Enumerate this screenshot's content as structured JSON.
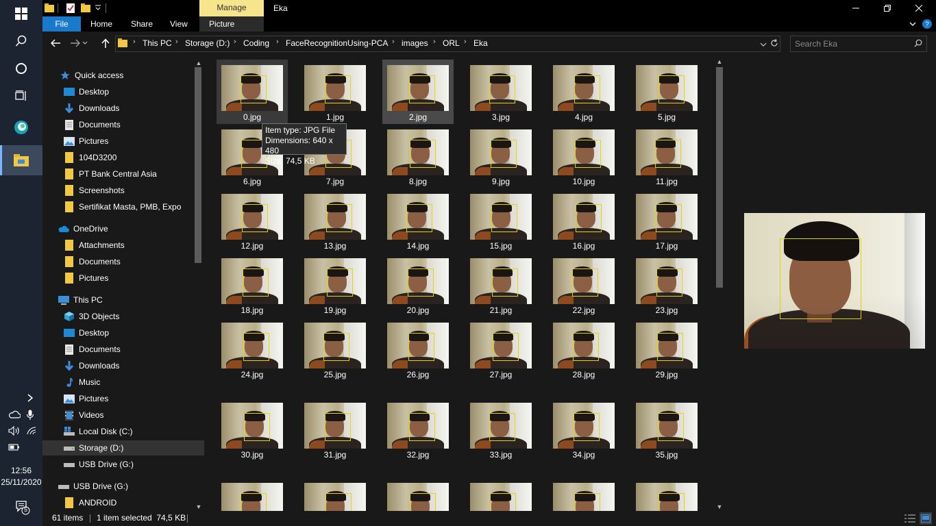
{
  "taskbar": {
    "clock_time": "12:56",
    "clock_date": "25/11/2020",
    "notifications_count": "5"
  },
  "window": {
    "title": "Eka",
    "contextual_tab": "Manage"
  },
  "ribbon": {
    "tabs": [
      "File",
      "Home",
      "Share",
      "View",
      "Picture Tools"
    ]
  },
  "address": {
    "crumbs": [
      "This PC",
      "Storage (D:)",
      "Coding",
      "FaceRecognitionUsing-PCA",
      "images",
      "ORL",
      "Eka"
    ]
  },
  "search": {
    "placeholder": "Search Eka"
  },
  "nav": {
    "items": [
      {
        "label": "Quick access",
        "icon": "star-icon"
      },
      {
        "label": "Desktop",
        "icon": "desktop-folder-icon"
      },
      {
        "label": "Downloads",
        "icon": "download-arrow-icon"
      },
      {
        "label": "Documents",
        "icon": "documents-icon"
      },
      {
        "label": "Pictures",
        "icon": "pictures-icon"
      },
      {
        "label": "104D3200",
        "icon": "folder-icon"
      },
      {
        "label": "PT Bank Central Asia",
        "icon": "folder-icon"
      },
      {
        "label": "Screenshots",
        "icon": "folder-icon"
      },
      {
        "label": "Sertifikat Masta, PMB, Expo",
        "icon": "folder-icon"
      },
      {
        "label": "OneDrive",
        "icon": "cloud-icon"
      },
      {
        "label": "Attachments",
        "icon": "folder-icon"
      },
      {
        "label": "Documents",
        "icon": "folder-icon"
      },
      {
        "label": "Pictures",
        "icon": "folder-icon"
      },
      {
        "label": "This PC",
        "icon": "computer-icon"
      },
      {
        "label": "3D Objects",
        "icon": "cube-icon"
      },
      {
        "label": "Desktop",
        "icon": "desktop-folder-icon"
      },
      {
        "label": "Documents",
        "icon": "documents-icon"
      },
      {
        "label": "Downloads",
        "icon": "download-arrow-icon"
      },
      {
        "label": "Music",
        "icon": "music-note-icon"
      },
      {
        "label": "Pictures",
        "icon": "pictures-icon"
      },
      {
        "label": "Videos",
        "icon": "video-icon"
      },
      {
        "label": "Local Disk (C:)",
        "icon": "system-drive-icon"
      },
      {
        "label": "Storage (D:)",
        "icon": "drive-icon"
      },
      {
        "label": "USB Drive (G:)",
        "icon": "drive-icon"
      },
      {
        "label": "USB Drive (G:)",
        "icon": "drive-icon"
      },
      {
        "label": "ANDROID",
        "icon": "folder-icon"
      }
    ]
  },
  "files": {
    "names": [
      "0.jpg",
      "1.jpg",
      "2.jpg",
      "3.jpg",
      "4.jpg",
      "5.jpg",
      "6.jpg",
      "7.jpg",
      "8.jpg",
      "9.jpg",
      "10.jpg",
      "11.jpg",
      "12.jpg",
      "13.jpg",
      "14.jpg",
      "15.jpg",
      "16.jpg",
      "17.jpg",
      "18.jpg",
      "19.jpg",
      "20.jpg",
      "21.jpg",
      "22.jpg",
      "23.jpg",
      "24.jpg",
      "25.jpg",
      "26.jpg",
      "27.jpg",
      "28.jpg",
      "29.jpg",
      "30.jpg",
      "31.jpg",
      "32.jpg",
      "33.jpg",
      "34.jpg",
      "35.jpg",
      "",
      "",
      "",
      "",
      "",
      ""
    ]
  },
  "tooltip": {
    "line1": "Item type: JPG File",
    "line2": "Dimensions: 640 x 480",
    "line3": "Size: 74,5 KB"
  },
  "status": {
    "items": "61 items",
    "selection": "1 item selected  74,5 KB"
  },
  "colors": {
    "accent": "#1979ca",
    "manage_tab": "#f6e58c",
    "face_box": "#e0d414"
  }
}
